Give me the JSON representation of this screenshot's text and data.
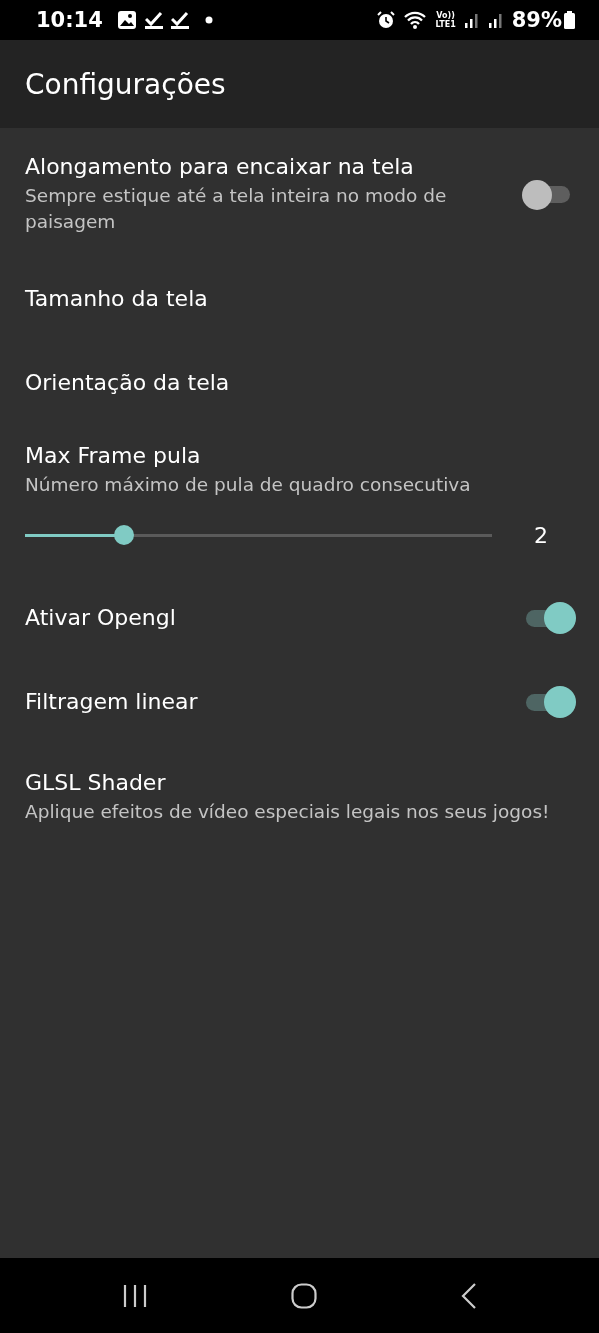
{
  "status_bar": {
    "time": "10:14",
    "volte_top": "Vo))",
    "volte_bottom": "LTE1",
    "battery": "89%"
  },
  "app_bar": {
    "title": "Configurações"
  },
  "settings": [
    {
      "kind": "switch",
      "title": "Alongamento para encaixar na tela",
      "summary": "Sempre estique até a tela inteira no modo de paisagem",
      "on": false
    },
    {
      "kind": "plain",
      "title": "Tamanho da tela"
    },
    {
      "kind": "plain",
      "title": "Orientação da tela"
    },
    {
      "kind": "slider",
      "title": "Max Frame pula",
      "summary": "Número máximo de pula de quadro consecutiva",
      "level": 0.2,
      "reading": "2"
    },
    {
      "kind": "switch",
      "title": "Ativar Opengl",
      "on": true
    },
    {
      "kind": "switch",
      "title": "Filtragem linear",
      "on": true
    },
    {
      "kind": "plain",
      "title": "GLSL Shader",
      "summary": "Aplique efeitos de vídeo especiais legais nos seus jogos!"
    }
  ]
}
